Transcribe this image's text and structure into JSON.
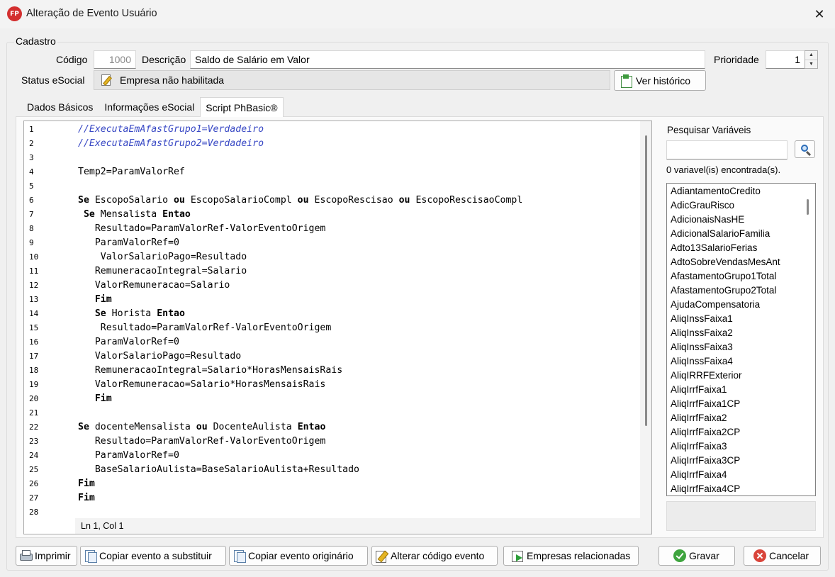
{
  "window": {
    "title": "Alteração de Evento Usuário",
    "logo": "FP"
  },
  "cadastro": {
    "legend": "Cadastro",
    "codigo_label": "Código",
    "codigo_value": "1000",
    "descricao_label": "Descrição",
    "descricao_value": "Saldo de Salário em Valor",
    "prioridade_label": "Prioridade",
    "prioridade_value": "1",
    "status_label": "Status eSocial",
    "status_value": "Empresa não habilitada",
    "ver_historico": "Ver histórico"
  },
  "tabs": [
    {
      "label": "Dados Básicos"
    },
    {
      "label": "Informações eSocial"
    },
    {
      "label": "Script PhBasic®"
    }
  ],
  "editor": {
    "status": "Ln 1, Col 1",
    "lines": [
      {
        "num": "1",
        "text": "//ExecutaEmAfastGrupo1=Verdadeiro"
      },
      {
        "num": "2",
        "text": "//ExecutaEmAfastGrupo2=Verdadeiro"
      },
      {
        "num": "3",
        "text": ""
      },
      {
        "num": "4",
        "text": "Temp2=ParamValorRef"
      },
      {
        "num": "5",
        "text": ""
      },
      {
        "num": "6",
        "text": "Se EscopoSalario ou EscopoSalarioCompl ou EscopoRescisao ou EscopoRescisaoCompl"
      },
      {
        "num": "7",
        "text": " Se Mensalista Entao"
      },
      {
        "num": "8",
        "text": "   Resultado=ParamValorRef-ValorEventoOrigem"
      },
      {
        "num": "9",
        "text": "   ParamValorRef=0"
      },
      {
        "num": "10",
        "text": "    ValorSalarioPago=Resultado"
      },
      {
        "num": "11",
        "text": "   RemuneracaoIntegral=Salario"
      },
      {
        "num": "12",
        "text": "   ValorRemuneracao=Salario"
      },
      {
        "num": "13",
        "text": "   Fim"
      },
      {
        "num": "14",
        "text": "   Se Horista Entao"
      },
      {
        "num": "15",
        "text": "    Resultado=ParamValorRef-ValorEventoOrigem"
      },
      {
        "num": "16",
        "text": "   ParamValorRef=0"
      },
      {
        "num": "17",
        "text": "   ValorSalarioPago=Resultado"
      },
      {
        "num": "18",
        "text": "   RemuneracaoIntegral=Salario*HorasMensaisRais"
      },
      {
        "num": "19",
        "text": "   ValorRemuneracao=Salario*HorasMensaisRais"
      },
      {
        "num": "20",
        "text": "   Fim"
      },
      {
        "num": "21",
        "text": ""
      },
      {
        "num": "22",
        "text": "Se docenteMensalista ou DocenteAulista Entao"
      },
      {
        "num": "23",
        "text": "   Resultado=ParamValorRef-ValorEventoOrigem"
      },
      {
        "num": "24",
        "text": "   ParamValorRef=0"
      },
      {
        "num": "25",
        "text": "   BaseSalarioAulista=BaseSalarioAulista+Resultado"
      },
      {
        "num": "26",
        "text": "Fim"
      },
      {
        "num": "27",
        "text": "Fim"
      },
      {
        "num": "28",
        "text": ""
      }
    ]
  },
  "variables": {
    "search_label": "Pesquisar Variáveis",
    "search_value": "",
    "found_text": "0 variavel(is) encontrada(s).",
    "items": [
      "AdiantamentoCredito",
      "AdicGrauRisco",
      "AdicionaisNasHE",
      "AdicionalSalarioFamilia",
      "Adto13SalarioFerias",
      "AdtoSobreVendasMesAnt",
      "AfastamentoGrupo1Total",
      "AfastamentoGrupo2Total",
      "AjudaCompensatoria",
      "AliqInssFaixa1",
      "AliqInssFaixa2",
      "AliqInssFaixa3",
      "AliqInssFaixa4",
      "AliqIRRFExterior",
      "AliqIrrfFaixa1",
      "AliqIrrfFaixa1CP",
      "AliqIrrfFaixa2",
      "AliqIrrfFaixa2CP",
      "AliqIrrfFaixa3",
      "AliqIrrfFaixa3CP",
      "AliqIrrfFaixa4",
      "AliqIrrfFaixa4CP"
    ]
  },
  "footer": {
    "imprimir": "Imprimir",
    "copiar_substituir": "Copiar evento a substituir",
    "copiar_originario": "Copiar evento originário",
    "alterar_codigo": "Alterar código evento",
    "empresas_relacionadas": "Empresas relacionadas",
    "gravar": "Gravar",
    "cancelar": "Cancelar"
  },
  "colors": {
    "comment": "#3747c4",
    "logo": "#d32f2f"
  }
}
